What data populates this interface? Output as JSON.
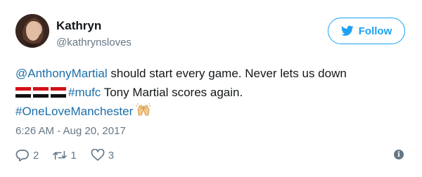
{
  "user": {
    "name": "Kathryn",
    "handle": "@kathrynsloves"
  },
  "follow_button": {
    "label": "Follow",
    "icon": "twitter-bird-icon"
  },
  "tweet": {
    "line1": {
      "mention": "@AnthonyMartial",
      "text": " should start every game. Never lets us down"
    },
    "line2": {
      "flags": "Egypt flag emoji x3",
      "hashtag": "#mufc",
      "text": " Tony Martial scores again."
    },
    "line3": {
      "hashtag": "#OneLoveManchester",
      "emoji": "raising-hands-emoji"
    }
  },
  "timestamp": "6:26 AM - Aug 20, 2017",
  "actions": {
    "reply_count": "2",
    "retweet_count": "1",
    "like_count": "3"
  },
  "colors": {
    "link": "#1b6ea8",
    "accent": "#1da1f2",
    "muted": "#657786",
    "text": "#14171a"
  }
}
